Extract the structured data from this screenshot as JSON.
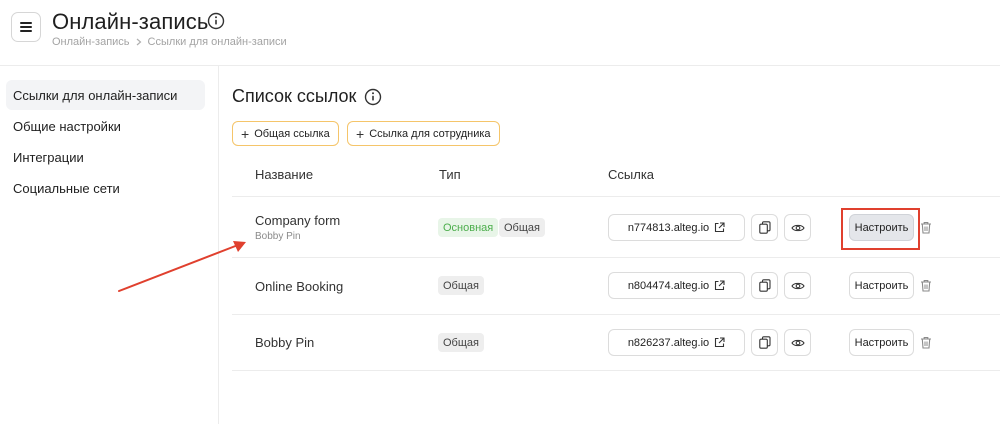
{
  "header": {
    "title": "Онлайн-запись",
    "breadcrumb": [
      "Онлайн-запись",
      "Ссылки для онлайн-записи"
    ]
  },
  "sidebar": {
    "items": [
      {
        "label": "Ссылки для онлайн-записи",
        "active": true
      },
      {
        "label": "Общие настройки",
        "active": false
      },
      {
        "label": "Интеграции",
        "active": false
      },
      {
        "label": "Социальные сети",
        "active": false
      }
    ]
  },
  "main": {
    "title": "Список ссылок",
    "buttons": {
      "common_link": "Общая ссылка",
      "employee_link": "Ссылка для сотрудника"
    },
    "columns": {
      "name": "Название",
      "type": "Тип",
      "link": "Ссылка"
    },
    "rows": [
      {
        "name": "Company form",
        "subtitle": "Bobby Pin",
        "badges": [
          "Основная",
          "Общая"
        ],
        "link": "n774813.alteg.io",
        "configure": "Настроить"
      },
      {
        "name": "Online Booking",
        "badges": [
          "Общая"
        ],
        "link": "n804474.alteg.io",
        "configure": "Настроить"
      },
      {
        "name": "Bobby Pin",
        "badges": [
          "Общая"
        ],
        "link": "n826237.alteg.io",
        "configure": "Настроить"
      }
    ]
  },
  "colors": {
    "accent_border": "#f5c56a",
    "annotation": "#e0402e",
    "badge_main_text": "#4cae4c",
    "badge_main_bg": "#e8f5e8"
  }
}
